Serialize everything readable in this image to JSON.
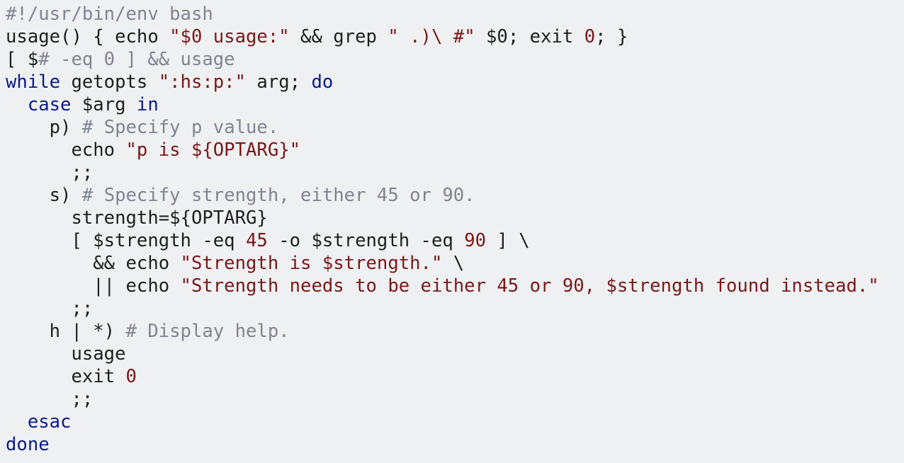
{
  "colors": {
    "background": "#eff0f2",
    "plain": "#1e1e1e",
    "keyword": "#0a1a8c",
    "string": "#7a1717",
    "number": "#7a1717",
    "comment": "#7e8590"
  },
  "code_lines": [
    [
      {
        "t": "#!/usr/bin/env bash",
        "k": "cmt"
      }
    ],
    [
      {
        "t": "usage() { echo ",
        "k": "plain"
      },
      {
        "t": "\"$0 usage:\"",
        "k": "str"
      },
      {
        "t": " && grep ",
        "k": "plain"
      },
      {
        "t": "\" .)\\ #\"",
        "k": "str"
      },
      {
        "t": " $0; exit ",
        "k": "plain"
      },
      {
        "t": "0",
        "k": "num"
      },
      {
        "t": "; }",
        "k": "plain"
      }
    ],
    [
      {
        "t": "[ $",
        "k": "plain"
      },
      {
        "t": "# -eq 0 ] && usage",
        "k": "cmt"
      }
    ],
    [
      {
        "t": "while",
        "k": "kw"
      },
      {
        "t": " getopts ",
        "k": "plain"
      },
      {
        "t": "\":hs:p:\"",
        "k": "str"
      },
      {
        "t": " arg; ",
        "k": "plain"
      },
      {
        "t": "do",
        "k": "kw"
      }
    ],
    [
      {
        "t": "  ",
        "k": "plain"
      },
      {
        "t": "case",
        "k": "kw"
      },
      {
        "t": " $arg ",
        "k": "plain"
      },
      {
        "t": "in",
        "k": "kw"
      }
    ],
    [
      {
        "t": "    p) ",
        "k": "plain"
      },
      {
        "t": "# Specify p value.",
        "k": "cmt"
      }
    ],
    [
      {
        "t": "      echo ",
        "k": "plain"
      },
      {
        "t": "\"p is ${OPTARG}\"",
        "k": "str"
      }
    ],
    [
      {
        "t": "      ;;",
        "k": "plain"
      }
    ],
    [
      {
        "t": "    s) ",
        "k": "plain"
      },
      {
        "t": "# Specify strength, either 45 or 90.",
        "k": "cmt"
      }
    ],
    [
      {
        "t": "      strength=${OPTARG}",
        "k": "plain"
      }
    ],
    [
      {
        "t": "      [ $strength -eq ",
        "k": "plain"
      },
      {
        "t": "45",
        "k": "num"
      },
      {
        "t": " -o $strength -eq ",
        "k": "plain"
      },
      {
        "t": "90",
        "k": "num"
      },
      {
        "t": " ] \\",
        "k": "plain"
      }
    ],
    [
      {
        "t": "        && echo ",
        "k": "plain"
      },
      {
        "t": "\"Strength is $strength.\"",
        "k": "str"
      },
      {
        "t": " \\",
        "k": "plain"
      }
    ],
    [
      {
        "t": "        || echo ",
        "k": "plain"
      },
      {
        "t": "\"Strength needs to be either 45 or 90, $strength found instead.\"",
        "k": "str"
      }
    ],
    [
      {
        "t": "      ;;",
        "k": "plain"
      }
    ],
    [
      {
        "t": "    h | *) ",
        "k": "plain"
      },
      {
        "t": "# Display help.",
        "k": "cmt"
      }
    ],
    [
      {
        "t": "      usage",
        "k": "plain"
      }
    ],
    [
      {
        "t": "      exit ",
        "k": "plain"
      },
      {
        "t": "0",
        "k": "num"
      }
    ],
    [
      {
        "t": "      ;;",
        "k": "plain"
      }
    ],
    [
      {
        "t": "  ",
        "k": "plain"
      },
      {
        "t": "esac",
        "k": "kw"
      }
    ],
    [
      {
        "t": "done",
        "k": "kw"
      }
    ]
  ]
}
